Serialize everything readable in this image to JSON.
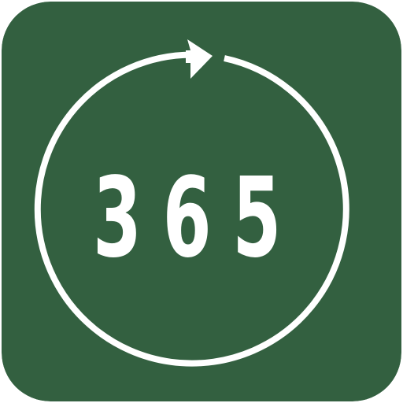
{
  "icon": {
    "text": "365",
    "background_color": "#336040",
    "foreground_color": "#ffffff",
    "symbol": "circular-refresh-arrow-icon"
  }
}
